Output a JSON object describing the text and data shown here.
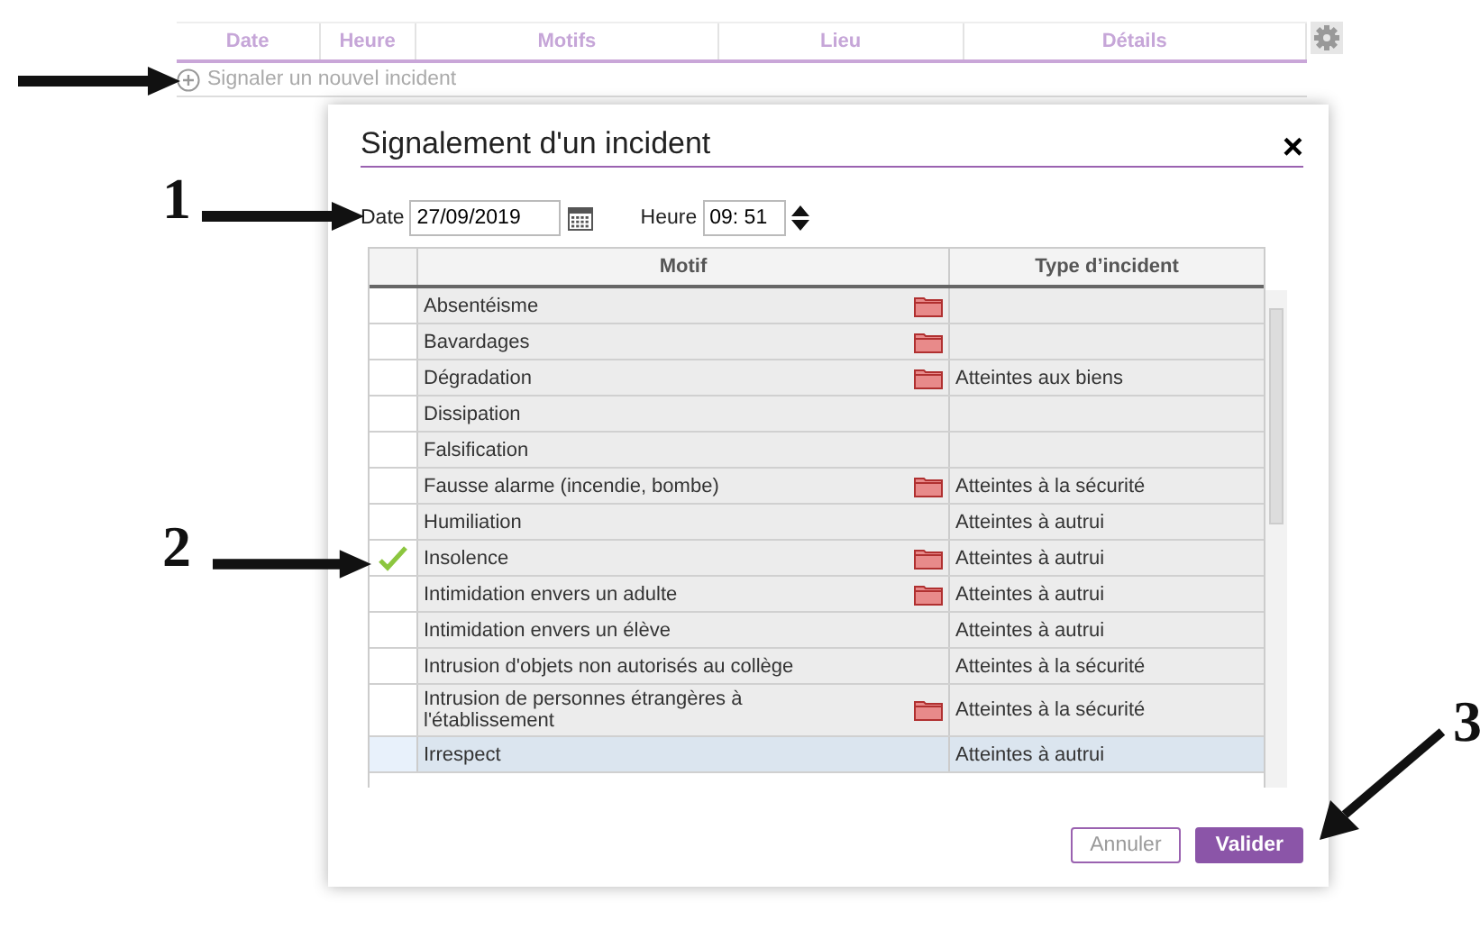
{
  "list": {
    "columns": [
      "Date",
      "Heure",
      "Motifs",
      "Lieu",
      "Détails"
    ],
    "add_link": "Signaler un nouvel incident"
  },
  "dialog": {
    "title": "Signalement d'un incident",
    "close": "×",
    "date_label": "Date",
    "date_value": "27/09/2019",
    "time_label": "Heure",
    "time_value": "09: 51",
    "grid": {
      "columns": [
        "Motif",
        "Type d’incident"
      ],
      "rows": [
        {
          "motif": "Absentéisme",
          "folder": true,
          "type": "",
          "checked": false,
          "selected": false
        },
        {
          "motif": "Bavardages",
          "folder": true,
          "type": "",
          "checked": false,
          "selected": false
        },
        {
          "motif": "Dégradation",
          "folder": true,
          "type": "Atteintes aux biens",
          "checked": false,
          "selected": false
        },
        {
          "motif": "Dissipation",
          "folder": false,
          "type": "",
          "checked": false,
          "selected": false
        },
        {
          "motif": "Falsification",
          "folder": false,
          "type": "",
          "checked": false,
          "selected": false
        },
        {
          "motif": "Fausse alarme (incendie, bombe)",
          "folder": true,
          "type": "Atteintes à la sécurité",
          "checked": false,
          "selected": false
        },
        {
          "motif": "Humiliation",
          "folder": false,
          "type": "Atteintes à autrui",
          "checked": false,
          "selected": false
        },
        {
          "motif": "Insolence",
          "folder": true,
          "type": "Atteintes à autrui",
          "checked": true,
          "selected": false
        },
        {
          "motif": "Intimidation envers un adulte",
          "folder": true,
          "type": "Atteintes à autrui",
          "checked": false,
          "selected": false
        },
        {
          "motif": "Intimidation envers un élève",
          "folder": false,
          "type": "Atteintes à autrui",
          "checked": false,
          "selected": false
        },
        {
          "motif": "Intrusion d'objets non autorisés au collège",
          "folder": false,
          "type": "Atteintes à la sécurité",
          "checked": false,
          "selected": false
        },
        {
          "motif": "Intrusion de personnes étrangères à l'établissement",
          "folder": true,
          "type": "Atteintes à la sécurité",
          "checked": false,
          "selected": false
        },
        {
          "motif": "Irrespect",
          "folder": false,
          "type": "Atteintes à autrui",
          "checked": false,
          "selected": true
        }
      ]
    },
    "buttons": [
      {
        "label": "Annuler",
        "kind": "secondary"
      },
      {
        "label": "Valider",
        "kind": "primary"
      }
    ]
  },
  "annotations": [
    {
      "label": "1"
    },
    {
      "label": "2"
    },
    {
      "label": "3"
    }
  ]
}
